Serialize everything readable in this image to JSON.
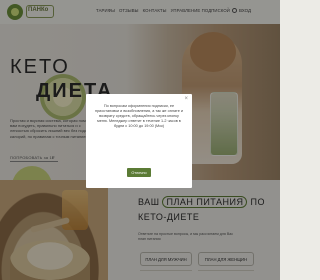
{
  "header": {
    "logo_text": "ПАНКо",
    "nav": [
      "ТАРИФЫ",
      "ОТЗЫВЫ",
      "КОНТАКТЫ",
      "УПРАВЛЕНИЕ ПОДПИСКОЙ"
    ],
    "login_label": "ВХОД"
  },
  "hero": {
    "title_line1": "КЕТО",
    "title_line2": "ДИЕТА",
    "description": "Простая и вкусная система, которая поможет вам похудеть, правильно питаться и с легкостью сбросить лишний вес без подсчета калорий, по правилам с точным питанием",
    "link_label": "ПОПРОБОВАТЬ за 1₽"
  },
  "plans": {
    "heading_prefix": "ВАШ",
    "heading_highlight": "ПЛАН ПИТАНИЯ",
    "heading_suffix": "ПО",
    "heading_line2": "КЕТО-ДИЕТЕ",
    "subtitle": "Ответьте на простые вопросы, и мы рассчитаем для Вас план питания",
    "btn_men": "ПЛАН ДЛЯ МУЖЧИН",
    "btn_women": "ПЛАН ДЛЯ ЖЕНЩИН"
  },
  "modal": {
    "close_glyph": "×",
    "text": "По вопросам оформления подписки, ее приостановки и возобновления, а так же оплате и возврату средств, обращайтесь через кнопку меню. Менеджер ответит в течение 1-2 часов в будни с 10:00 до 19:00 (Мск)",
    "ok_label": "Отлично"
  },
  "colors": {
    "accent": "#5b7b35",
    "overlay": "rgba(0,0,0,0.38)"
  }
}
